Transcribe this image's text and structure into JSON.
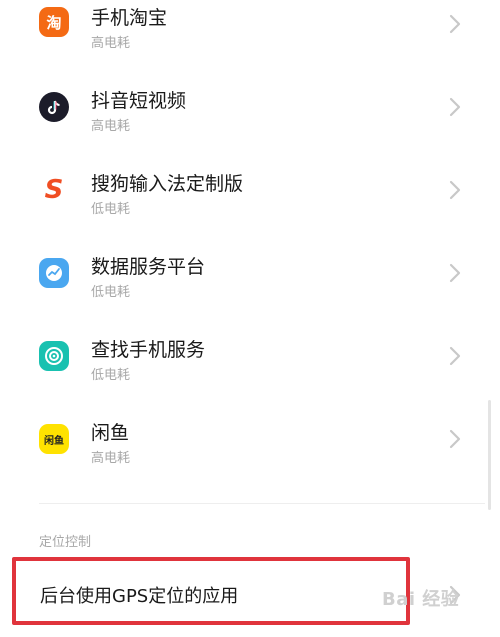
{
  "apps": [
    {
      "name": "手机淘宝",
      "power": "高电耗",
      "icon": "taobao-icon"
    },
    {
      "name": "抖音短视频",
      "power": "高电耗",
      "icon": "douyin-icon"
    },
    {
      "name": "搜狗输入法定制版",
      "power": "低电耗",
      "icon": "sogou-icon"
    },
    {
      "name": "数据服务平台",
      "power": "低电耗",
      "icon": "data-service-icon"
    },
    {
      "name": "查找手机服务",
      "power": "低电耗",
      "icon": "find-phone-icon"
    },
    {
      "name": "闲鱼",
      "power": "高电耗",
      "icon": "xianyu-icon"
    }
  ],
  "section": {
    "label": "定位控制"
  },
  "gps_item": {
    "label": "后台使用GPS定位的应用"
  },
  "icon_text": {
    "taobao": "淘",
    "sogou": "S",
    "xianyu": "闲鱼"
  },
  "watermark": {
    "text": "Bai 经验"
  },
  "colors": {
    "highlight": "#e0343c",
    "taobao": "#f46a14",
    "douyin": "#1c1c2a",
    "sogou": "#f04e23",
    "data_service": "#4aa7f0",
    "find_phone": "#19c1b0",
    "xianyu": "#ffe200"
  }
}
